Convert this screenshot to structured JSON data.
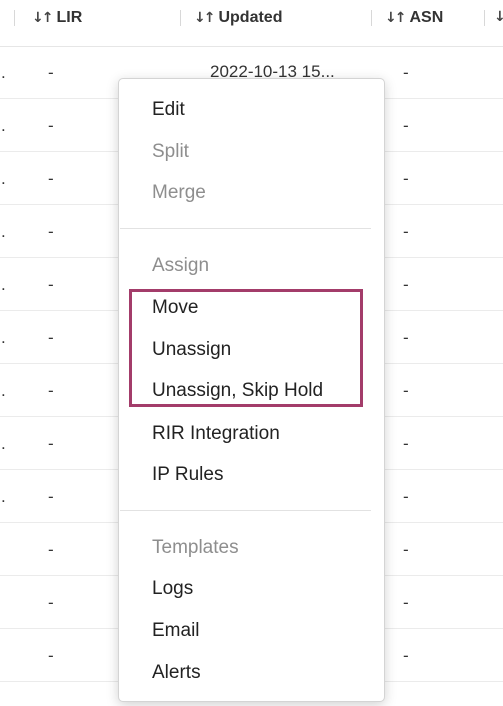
{
  "table": {
    "headers": [
      {
        "label": "LIR",
        "sort_icon": "sort-arrows-icon"
      },
      {
        "label": "Updated",
        "sort_icon": "sort-arrows-icon"
      },
      {
        "label": "ASN",
        "sort_icon": "sort-arrows-icon"
      }
    ],
    "rows": [
      {
        "lead": ".",
        "lir": "-",
        "updated": "2022-10-13 15...",
        "asn": "-"
      },
      {
        "lead": ".",
        "lir": "-",
        "updated": "",
        "asn": "-"
      },
      {
        "lead": ".",
        "lir": "-",
        "updated": "",
        "asn": "-"
      },
      {
        "lead": ".",
        "lir": "-",
        "updated": "",
        "asn": "-"
      },
      {
        "lead": ".",
        "lir": "-",
        "updated": "",
        "asn": "-"
      },
      {
        "lead": ".",
        "lir": "-",
        "updated": "",
        "asn": "-"
      },
      {
        "lead": ".",
        "lir": "-",
        "updated": "",
        "asn": "-"
      },
      {
        "lead": ".",
        "lir": "-",
        "updated": "",
        "asn": "-"
      },
      {
        "lead": ".",
        "lir": "-",
        "updated": "",
        "asn": "-"
      },
      {
        "lead": "",
        "lir": "-",
        "updated": "",
        "asn": "-"
      },
      {
        "lead": "",
        "lir": "-",
        "updated": "",
        "asn": "-"
      },
      {
        "lead": "",
        "lir": "-",
        "updated": "",
        "asn": "-"
      }
    ]
  },
  "context_menu": {
    "items": [
      {
        "label": "Edit",
        "disabled": false
      },
      {
        "label": "Split",
        "disabled": true
      },
      {
        "label": "Merge",
        "disabled": true
      },
      {
        "label": "Assign",
        "disabled": true
      },
      {
        "label": "Move",
        "disabled": false
      },
      {
        "label": "Unassign",
        "disabled": false
      },
      {
        "label": "Unassign, Skip Hold",
        "disabled": false
      },
      {
        "label": "RIR Integration",
        "disabled": false
      },
      {
        "label": "IP Rules",
        "disabled": false
      },
      {
        "label": "Templates",
        "disabled": true
      },
      {
        "label": "Logs",
        "disabled": false
      },
      {
        "label": "Email",
        "disabled": false
      },
      {
        "label": "Alerts",
        "disabled": false
      }
    ]
  },
  "colors": {
    "highlight_border": "#a33c6a",
    "disabled_text": "#8e8e8e"
  }
}
